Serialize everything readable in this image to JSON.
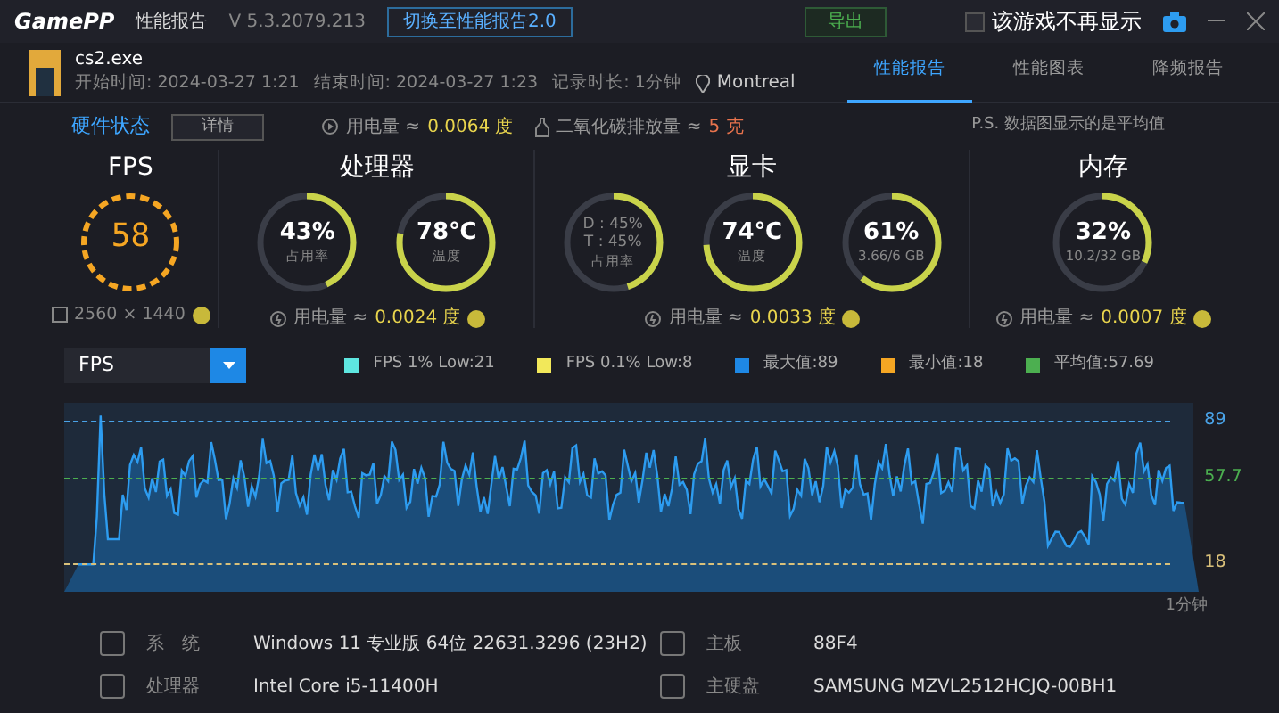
{
  "title_bar": {
    "logo": "GamePP",
    "title": "性能报告",
    "version": "V 5.3.2079.213",
    "switch_button": "切换至性能报告2.0",
    "export_button": "导出",
    "dont_show": {
      "label": "该游戏不再显示",
      "checked": false
    }
  },
  "session": {
    "game": "cs2.exe",
    "start": "开始时间: 2024-03-27 1:21",
    "end": "结束时间: 2024-03-27 1:23",
    "duration": "记录时长: 1分钟",
    "location": "Montreal"
  },
  "tabs": [
    {
      "label": "性能报告",
      "selected": true
    },
    {
      "label": "性能图表",
      "selected": false
    },
    {
      "label": "降频报告",
      "selected": false
    }
  ],
  "hardware_bar": {
    "title": "硬件状态",
    "details_button": "详情",
    "power_label": "用电量 ≈",
    "power_value": "0.0064 度",
    "co2_label": "二氧化碳排放量 ≈",
    "co2_value": "5 克",
    "note": "P.S. 数据图显示的是平均值"
  },
  "sections": [
    {
      "kind": "fps",
      "title": "FPS",
      "fps": "58",
      "resolution": "2560 × 1440"
    },
    {
      "kind": "gauges",
      "title": "处理器",
      "gauges": [
        {
          "value": "43%",
          "label": "占用率",
          "level": 0.43
        },
        {
          "value": "78℃",
          "label": "温度",
          "level": 0.78
        }
      ],
      "power_label": "用电量 ≈",
      "power_value": "0.0024 度"
    },
    {
      "kind": "gauges",
      "title": "显卡",
      "gauges": [
        {
          "lines": [
            "D : 45%",
            "T : 45%"
          ],
          "label": "占用率",
          "level": 0.45
        },
        {
          "value": "74℃",
          "label": "温度",
          "level": 0.74
        },
        {
          "value": "61%",
          "label": "3.66/6 GB",
          "level": 0.61
        }
      ],
      "power_label": "用电量 ≈",
      "power_value": "0.0033 度"
    },
    {
      "kind": "gauges",
      "title": "内存",
      "gauges": [
        {
          "value": "32%",
          "label": "10.2/32 GB",
          "level": 0.32
        }
      ],
      "power_label": "用电量 ≈",
      "power_value": "0.0007 度"
    }
  ],
  "chart": {
    "metric": "FPS",
    "legend": [
      {
        "label": "FPS 1% Low:21",
        "color": "#5ee6e0"
      },
      {
        "label": "FPS 0.1% Low:8",
        "color": "#f2e85a"
      },
      {
        "label": "最大值:89",
        "color": "#1e88e5"
      },
      {
        "label": "最小值:18",
        "color": "#f5a623"
      },
      {
        "label": "平均值:57.69",
        "color": "#4caf50"
      }
    ],
    "ref_lines": [
      {
        "label": "89",
        "kind": "max"
      },
      {
        "label": "57.7",
        "kind": "avg"
      },
      {
        "label": "18",
        "kind": "min"
      }
    ],
    "x_label": "1分钟"
  },
  "system_info": [
    {
      "label": "系　统",
      "value": "Windows 11 专业版 64位 22631.3296 (23H2)",
      "label2": "主板",
      "value2": "88F4"
    },
    {
      "label": "处理器",
      "value": "Intel Core i5-11400H",
      "label2": "主硬盘",
      "value2": "SAMSUNG MZVL2512HCJQ-00BH1"
    }
  ]
}
